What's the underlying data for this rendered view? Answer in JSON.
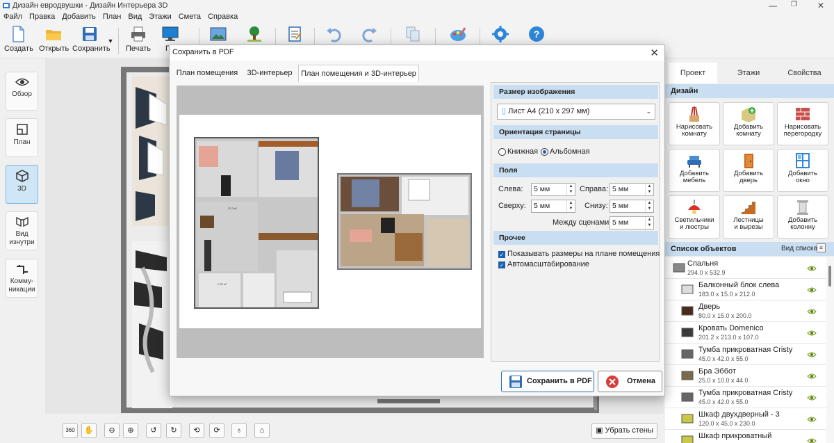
{
  "window": {
    "title": "Дизайн евродвушки - Дизайн Интерьера 3D"
  },
  "menu": [
    "Файл",
    "Правка",
    "Добавить",
    "План",
    "Вид",
    "Этажи",
    "Смета",
    "Справка"
  ],
  "toolbar": {
    "create": "Создать",
    "open": "Открыть",
    "save": "Сохранить",
    "print": "Печать",
    "preview_cut": "Пр"
  },
  "nav": {
    "overview": "Обзор",
    "plan": "План",
    "view3d": "3D",
    "inside1": "Вид",
    "inside2": "изнутри",
    "comm1": "Комму-",
    "comm2": "никации"
  },
  "bottom": {
    "rotate360": "360",
    "hide_walls": "Убрать стены"
  },
  "right": {
    "tabs": [
      "Проект",
      "Этажи",
      "Свойства"
    ],
    "design_header": "Дизайн",
    "design": [
      [
        "Нарисовать",
        "комнату"
      ],
      [
        "Добавить",
        "комнату"
      ],
      [
        "Нарисовать",
        "перегородку"
      ],
      [
        "Добавить",
        "мебель"
      ],
      [
        "Добавить",
        "дверь"
      ],
      [
        "Добавить",
        "окно"
      ],
      [
        "Светильники",
        "и люстры"
      ],
      [
        "Лестницы",
        "и вырезы"
      ],
      [
        "Добавить",
        "колонну"
      ]
    ],
    "objects_header": "Список объектов",
    "view_list": "Вид списка",
    "objects": [
      {
        "name": "Спальня",
        "dims": "294.0 x 532.9"
      },
      {
        "name": "Балконный блок слева",
        "dims": "183.0 x 15.0 x 212.0"
      },
      {
        "name": "Дверь",
        "dims": "80.0 x 15.0 x 200.0"
      },
      {
        "name": "Кровать Domenico",
        "dims": "201.2 x 213.0 x 107.0"
      },
      {
        "name": "Тумба прикроватная Cristy",
        "dims": "45.0 x 42.0 x 55.0"
      },
      {
        "name": "Бра Эббот",
        "dims": "25.0 x 10.0 x 44.0"
      },
      {
        "name": "Тумба прикроватная Cristy",
        "dims": "45.0 x 42.0 x 55.0"
      },
      {
        "name": "Шкаф двухдверный - 3",
        "dims": "120.0 x 45.0 x 230.0"
      },
      {
        "name": "Шкаф прикроватный",
        "dims": ""
      }
    ]
  },
  "dialog": {
    "title": "Сохранить в PDF",
    "tabs": [
      "План помещения",
      "3D-интерьер",
      "План помещения и 3D-интерьер"
    ],
    "size_header": "Размер изображения",
    "paper": "Лист A4 (210 x 297 мм)",
    "orient_header": "Ориентация страницы",
    "portrait": "Книжная",
    "landscape": "Альбомная",
    "margins_header": "Поля",
    "left": "Слева:",
    "right": "Справа:",
    "top": "Сверху:",
    "bottom": "Снизу:",
    "between": "Между сценами:",
    "left_val": "5 мм",
    "right_val": "5 мм",
    "top_val": "5 мм",
    "bottom_val": "5 мм",
    "between_val": "5 мм",
    "other_header": "Прочее",
    "show_dims": "Показывать размеры на плане помещения",
    "autoscale": "Автомасштабирование",
    "save_btn": "Сохранить в PDF",
    "cancel_btn": "Отмена",
    "plan_area": "32,3 м²",
    "plan_area2": "2,32 м²"
  }
}
